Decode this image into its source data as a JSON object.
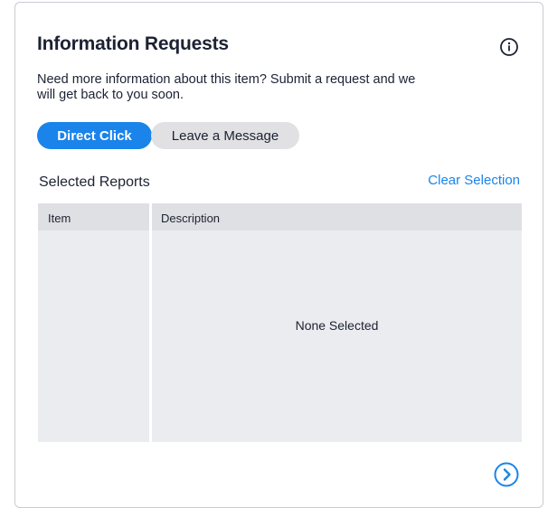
{
  "panel": {
    "title": "Information Requests",
    "description": "Need more information about this item? Submit a request and we will get back to you soon.",
    "info_icon": "info-circle-icon"
  },
  "actions": {
    "direct_click_label": "Direct Click",
    "leave_message_label": "Leave a Message"
  },
  "selection": {
    "section_label": "Selected Reports",
    "clear_label": "Clear Selection"
  },
  "table": {
    "columns": [
      "Item",
      "Description"
    ],
    "empty_text": "None Selected"
  },
  "footer": {
    "next_icon": "chevron-right-circle-icon"
  },
  "colors": {
    "accent": "#1a84ea",
    "secondary_button_bg": "#e1e1e3",
    "table_bg": "#ebecef",
    "table_header_bg": "#dfe0e4",
    "text": "#1c2233"
  }
}
